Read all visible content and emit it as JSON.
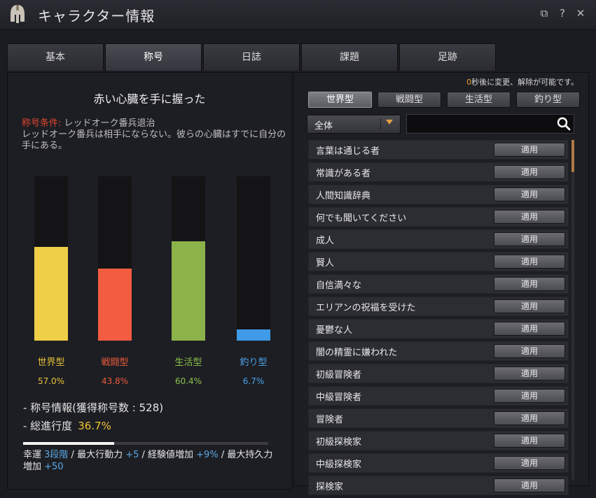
{
  "window": {
    "title": "キャラクター情報"
  },
  "tabs": [
    {
      "label": "基本"
    },
    {
      "label": "称号"
    },
    {
      "label": "日誌"
    },
    {
      "label": "課題"
    },
    {
      "label": "足跡"
    }
  ],
  "active_tab": "称号",
  "left": {
    "title_name": "赤い心臓を手に握った",
    "condition_label": "称号条件:",
    "condition_text": " レッドオーク番兵退治",
    "description": "レッドオーク番兵は相手にならない。彼らの心臓はすでに自分の手にある。",
    "info_line": "- 称号情報(獲得称号数 : 528)",
    "overall_label": "- 総進行度",
    "overall_value": "36.7%",
    "bonus": {
      "p1": "幸運 ",
      "v1": "3段階",
      "p2": " / 最大行動力 ",
      "v2": "+5",
      "p3": " / 経験値増加 ",
      "v3": "+9%",
      "p4": " / 最大持久力増加 ",
      "v4": "+50"
    }
  },
  "progress": {
    "value": 0.37
  },
  "chart_data": {
    "type": "bar",
    "categories": [
      "世界型",
      "戦闘型",
      "生活型",
      "釣り型"
    ],
    "values": [
      57.0,
      43.8,
      60.4,
      6.7
    ],
    "labels": [
      "57.0%",
      "43.8%",
      "60.4%",
      "6.7%"
    ],
    "ylim": [
      0,
      100
    ],
    "colors": [
      "#efcf46",
      "#f45c41",
      "#8cb24a",
      "#3f9be8"
    ],
    "label_colors": [
      "#e6c23a",
      "#ea5a3c",
      "#8cc04a",
      "#4aa3ea"
    ]
  },
  "right": {
    "notice_zero": "0",
    "notice": "秒後に変更、解除が可能です。",
    "filters": [
      "世界型",
      "戦闘型",
      "生活型",
      "釣り型"
    ],
    "active_filter": "世界型",
    "dropdown_value": "全体",
    "search_placeholder": "",
    "apply_label": "適用",
    "titles": [
      "言葉は通じる者",
      "常識がある者",
      "人間知識辞典",
      "何でも聞いてください",
      "成人",
      "賢人",
      "自信満々な",
      "エリアンの祝福を受けた",
      "憂鬱な人",
      "闇の精霊に嫌われた",
      "初級冒険者",
      "中級冒険者",
      "冒険者",
      "初級探検家",
      "中級探検家",
      "探検家"
    ]
  },
  "icons": {
    "logo": "spartan-helmet-icon",
    "popout": "popout-icon",
    "help": "help-icon",
    "close": "close-icon",
    "search": "search-icon",
    "dropdown": "chevron-down-icon"
  }
}
